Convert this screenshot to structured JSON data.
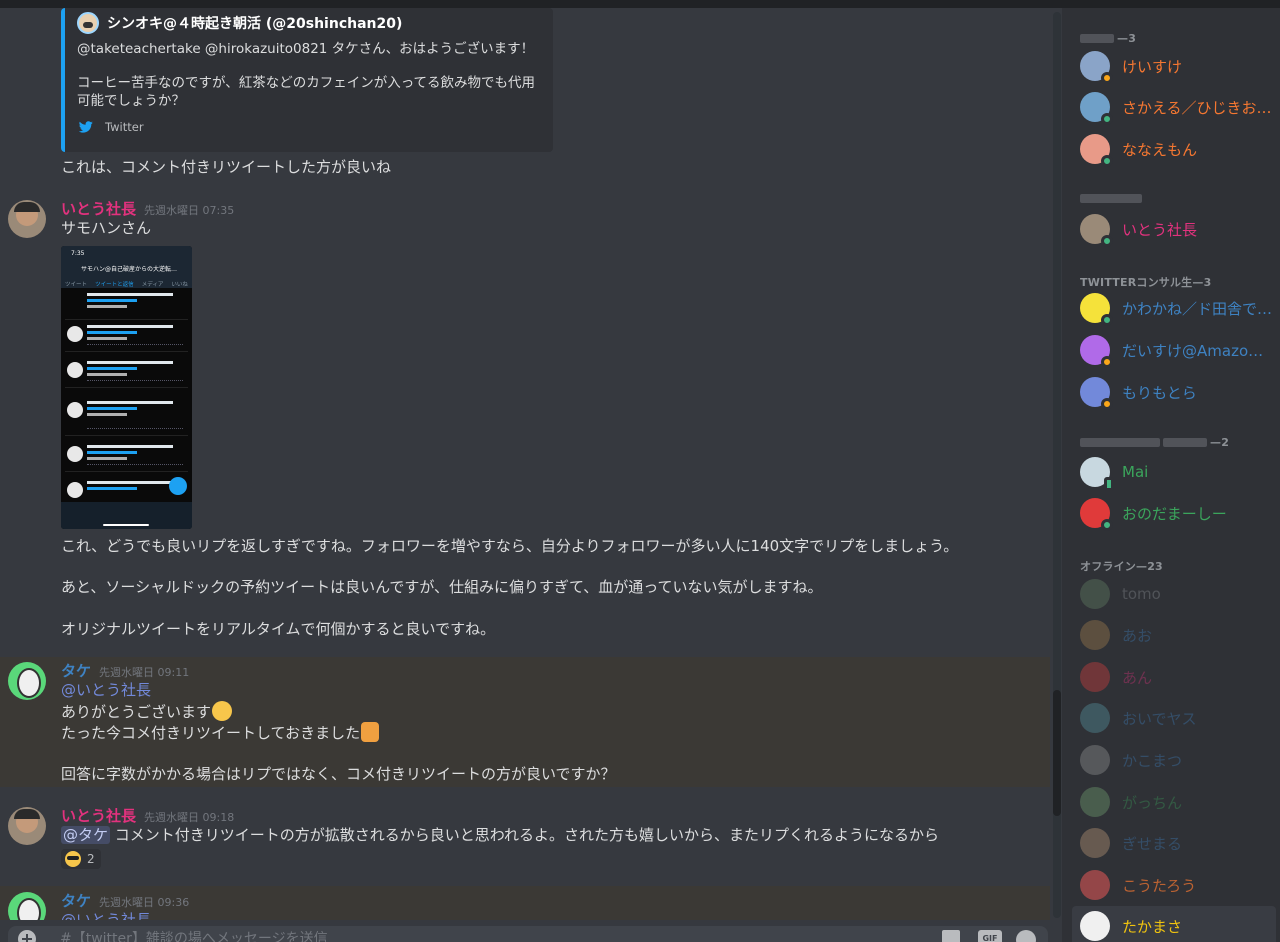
{
  "embed": {
    "author": "シンオキ@４時起き朝活 (@20shinchan20)",
    "body_lines": [
      "@taketeachertake @hirokazuito0821 タケさん、おはようございます！",
      "コーヒー苦手なのですが、紅茶などのカフェインが入ってる飲み物でも代用可能でしょうか？"
    ],
    "footer": "Twitter"
  },
  "messages": [
    {
      "text": "これは、コメント付きリツイートした方が良いね"
    },
    {
      "author": "いとう社長",
      "timestamp": "先週水曜日 07:35",
      "lines": [
        "サモハンさん",
        "これ、どうでも良いリプを返しすぎですね。フォロワーを増やすなら、自分よりフォロワーが多い人に140文字でリプをしましょう。",
        "あと、ソーシャルドックの予約ツイートは良いんですが、仕組みに偏りすぎて、血が通っていない気がしますね。",
        "オリジナルツイートをリアルタイムで何個かすると良いですね。"
      ],
      "image": {
        "time": "7:35",
        "title": "サモハン@自己破産からの大逆転…",
        "tabs": [
          "ツイート",
          "ツイートと返信",
          "メディア",
          "いいね"
        ]
      }
    },
    {
      "author": "タケ",
      "timestamp": "先週水曜日 09:11",
      "mention": "@いとう社長",
      "lines": [
        "ありがとうございます",
        "たった今コメ付きリツイートしておきました",
        "回答に字数がかかる場合はリプではなく、コメ付きリツイートの方が良いですか？"
      ]
    },
    {
      "author": "いとう社長",
      "timestamp": "先週水曜日 09:18",
      "mention": "@タケ",
      "text": "コメント付きリツイートの方が拡散されるから良いと思われるよ。された方も嬉しいから、またリプくれるようになるから",
      "reaction_count": "2"
    },
    {
      "author": "タケ",
      "timestamp": "先週水曜日 09:36",
      "mention": "@いとう社長"
    }
  ],
  "composer": {
    "placeholder": "#【twitter】雑談の場へメッセージを送信",
    "gif_label": "GIF"
  },
  "members": {
    "groups": [
      {
        "header_suffix": "—3",
        "items": [
          {
            "name": "けいすけ",
            "color": "#f57731",
            "status": "idle"
          },
          {
            "name": "さかえる／ひじきお…",
            "color": "#f57731",
            "status": "online"
          },
          {
            "name": "ななえもん",
            "color": "#f57731",
            "status": "online"
          }
        ]
      },
      {
        "header_suffix": "",
        "items": [
          {
            "name": "いとう社長",
            "color": "#e2327e",
            "status": "online"
          }
        ]
      },
      {
        "header": "TWITTERコンサル生—3",
        "items": [
          {
            "name": "かわかね／ド田舎で…",
            "color": "#3e82c2",
            "status": "online"
          },
          {
            "name": "だいすけ@Amazonで…",
            "color": "#3e82c2",
            "status": "idle"
          },
          {
            "name": "もりもとら",
            "color": "#3e82c2",
            "status": "idle"
          }
        ]
      },
      {
        "header_suffix": "—2",
        "items": [
          {
            "name": "Mai",
            "color": "#3ba55c",
            "status": "mobile"
          },
          {
            "name": "おのだまーしー",
            "color": "#3ba55c",
            "status": "online"
          }
        ]
      },
      {
        "header": "オフライン—23",
        "items": [
          {
            "name": "tomo"
          },
          {
            "name": "あお"
          },
          {
            "name": "あん"
          },
          {
            "name": "おいでヤス"
          },
          {
            "name": "かこまつ"
          },
          {
            "name": "がっちん"
          },
          {
            "name": "ぎせまる"
          },
          {
            "name": "こうたろう"
          },
          {
            "name": "たかまさ"
          }
        ]
      }
    ]
  }
}
